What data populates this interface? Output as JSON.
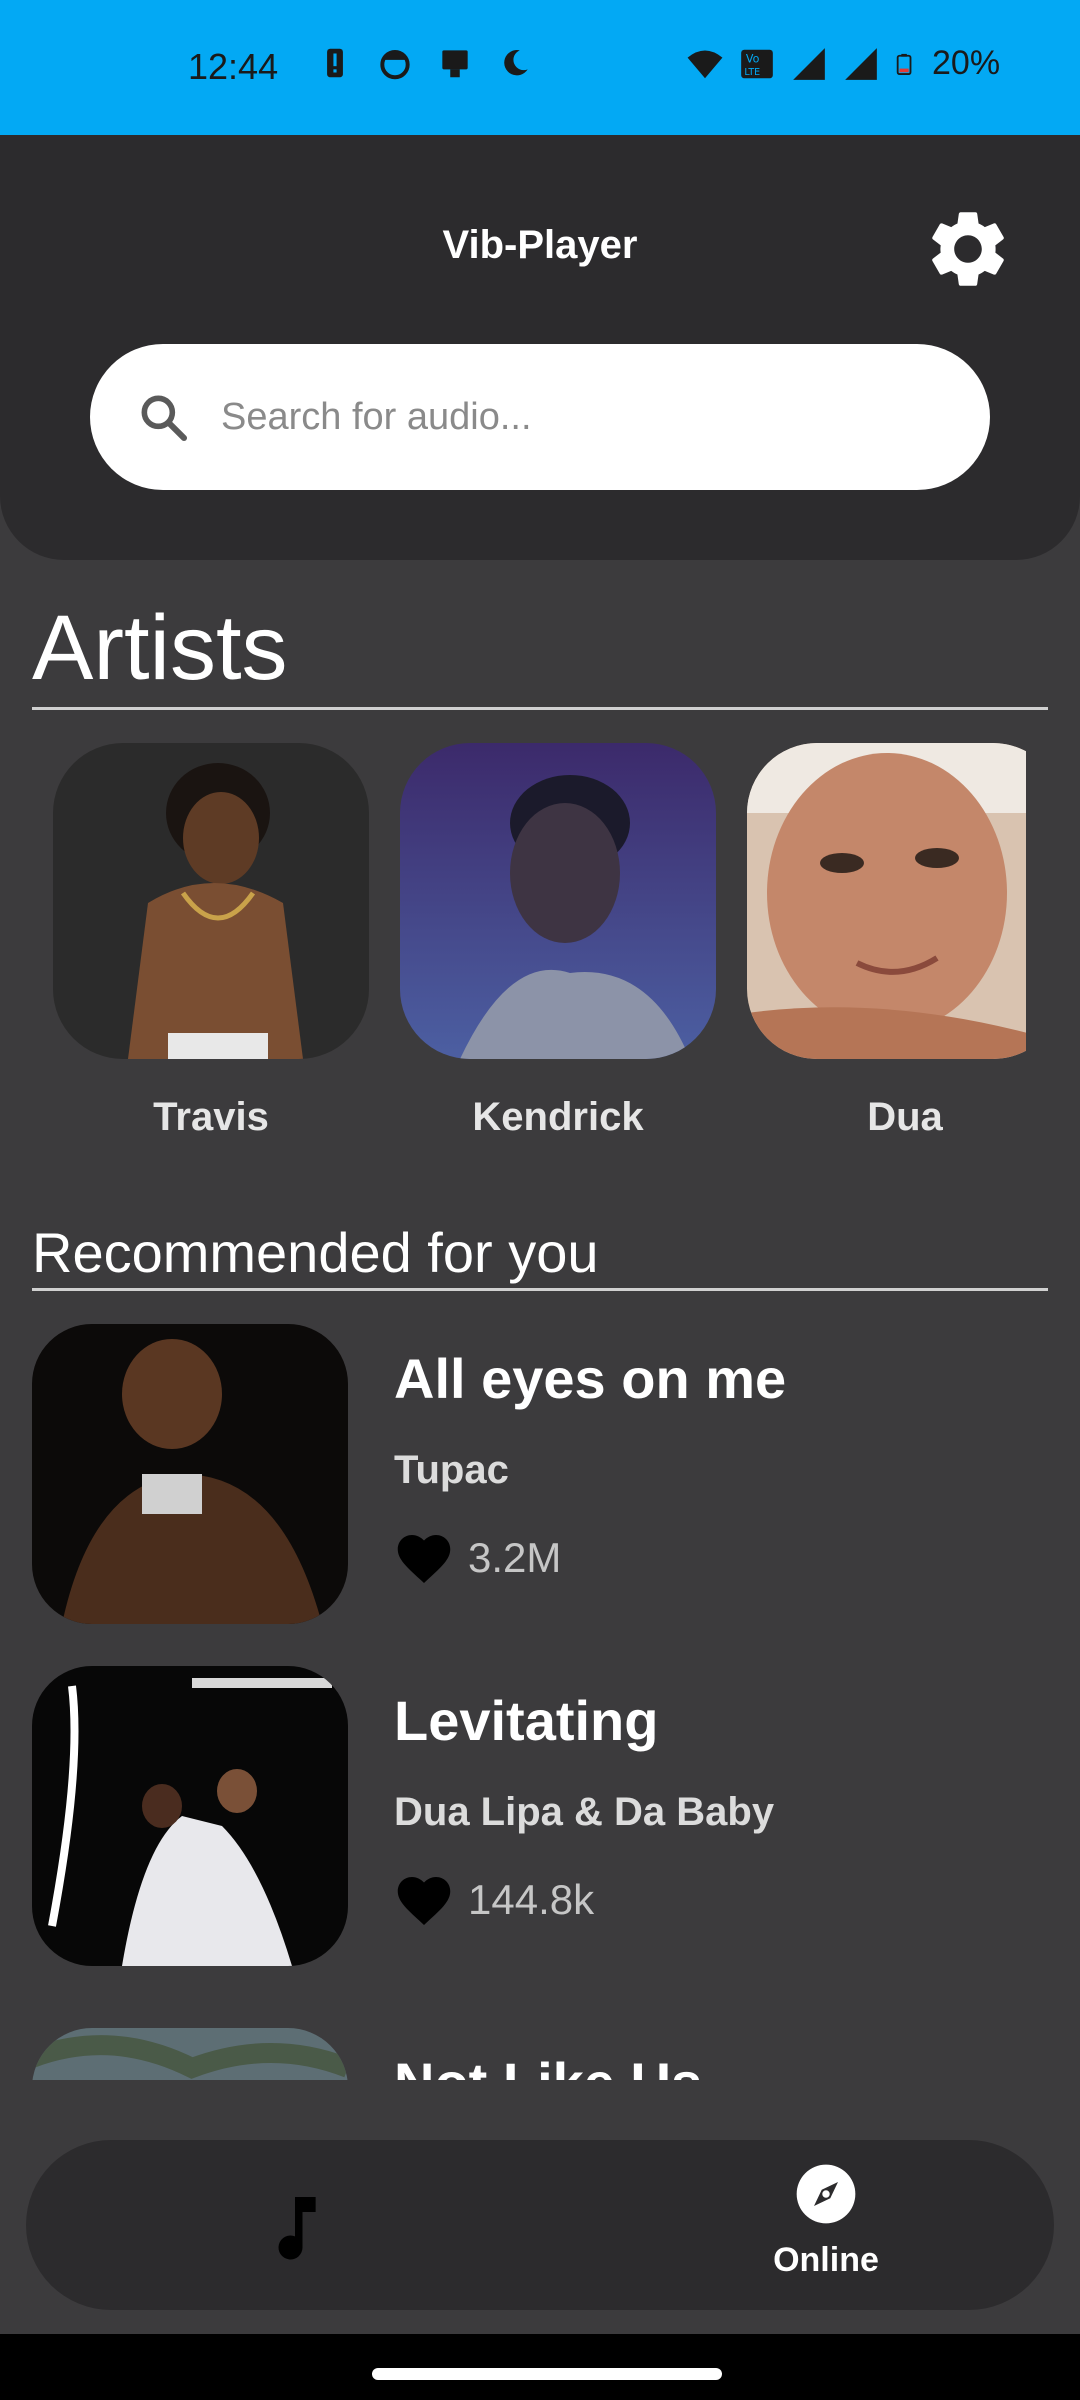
{
  "status_bar": {
    "time": "12:44",
    "battery": "20%",
    "left_icons": [
      "alert-icon",
      "face-icon",
      "device-icon",
      "moon-icon"
    ],
    "right_icons": [
      "wifi-icon",
      "volte-icon",
      "signal-icon",
      "signal-icon",
      "battery-icon"
    ]
  },
  "header": {
    "title": "Vib-Player",
    "settings_icon": "gear-icon"
  },
  "search": {
    "placeholder": "Search for audio..."
  },
  "artists": {
    "title": "Artists",
    "items": [
      {
        "name": "Travis"
      },
      {
        "name": "Kendrick"
      },
      {
        "name": "Dua"
      }
    ]
  },
  "recommended": {
    "title": "Recommended for you",
    "songs": [
      {
        "title": "All eyes on me",
        "artist": "Tupac",
        "likes": "3.2M"
      },
      {
        "title": "Levitating",
        "artist": "Dua Lipa & Da Baby",
        "likes": "144.8k"
      },
      {
        "title": "Not Like Us",
        "artist": "",
        "likes": ""
      }
    ]
  },
  "bottom_nav": {
    "library_icon": "music-note-icon",
    "online_label": "Online",
    "online_icon": "compass-icon"
  },
  "colors": {
    "status_bar": "#03a9f4",
    "background": "#3c3b3d",
    "header": "#2c2b2d"
  }
}
